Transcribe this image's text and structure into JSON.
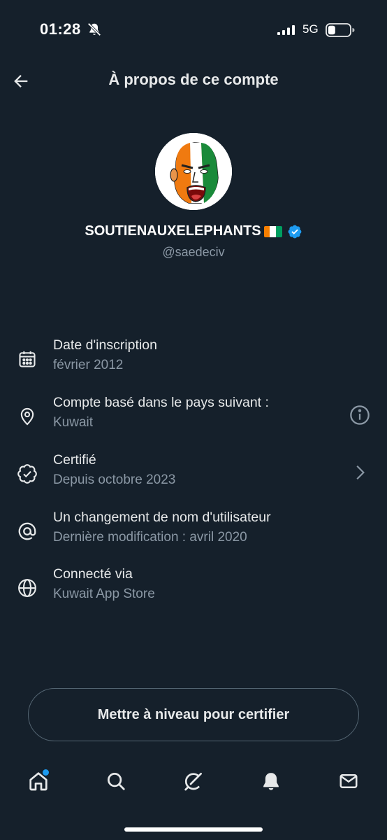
{
  "status_bar": {
    "time": "01:28",
    "network": "5G",
    "icons": [
      "bell-off-icon",
      "signal-icon",
      "battery-icon"
    ]
  },
  "header": {
    "title": "À propos de ce compte",
    "back_icon": "arrow-left-icon"
  },
  "profile": {
    "display_name": "SOUTIENAUXELEPHANTS",
    "flag_emoji": "🇨🇮",
    "flag_colors": [
      "#f77f00",
      "#ffffff",
      "#009e60"
    ],
    "verified": true,
    "handle": "@saedeciv"
  },
  "info_items": [
    {
      "icon": "calendar-icon",
      "title": "Date d'inscription",
      "subtitle": "février 2012",
      "action": null
    },
    {
      "icon": "location-pin-icon",
      "title": "Compte basé dans le pays suivant :",
      "subtitle": "Kuwait",
      "action": "info-icon"
    },
    {
      "icon": "verified-badge-icon",
      "title": "Certifié",
      "subtitle": "Depuis octobre 2023",
      "action": "chevron-right-icon"
    },
    {
      "icon": "at-sign-icon",
      "title": "Un changement de nom d'utilisateur",
      "subtitle": "Dernière modification : avril 2020",
      "action": null
    },
    {
      "icon": "globe-icon",
      "title": "Connecté via",
      "subtitle": "Kuwait App Store",
      "action": null
    }
  ],
  "upgrade_button": {
    "label": "Mettre à niveau pour certifier"
  },
  "tab_bar": {
    "tabs": [
      "home-icon",
      "search-icon",
      "grok-icon",
      "notifications-icon",
      "messages-icon"
    ],
    "home_has_badge": true
  },
  "colors": {
    "background": "#15202b",
    "accent": "#1d9bf0",
    "text_primary": "#e7e9ea",
    "text_secondary": "#8b98a5"
  }
}
